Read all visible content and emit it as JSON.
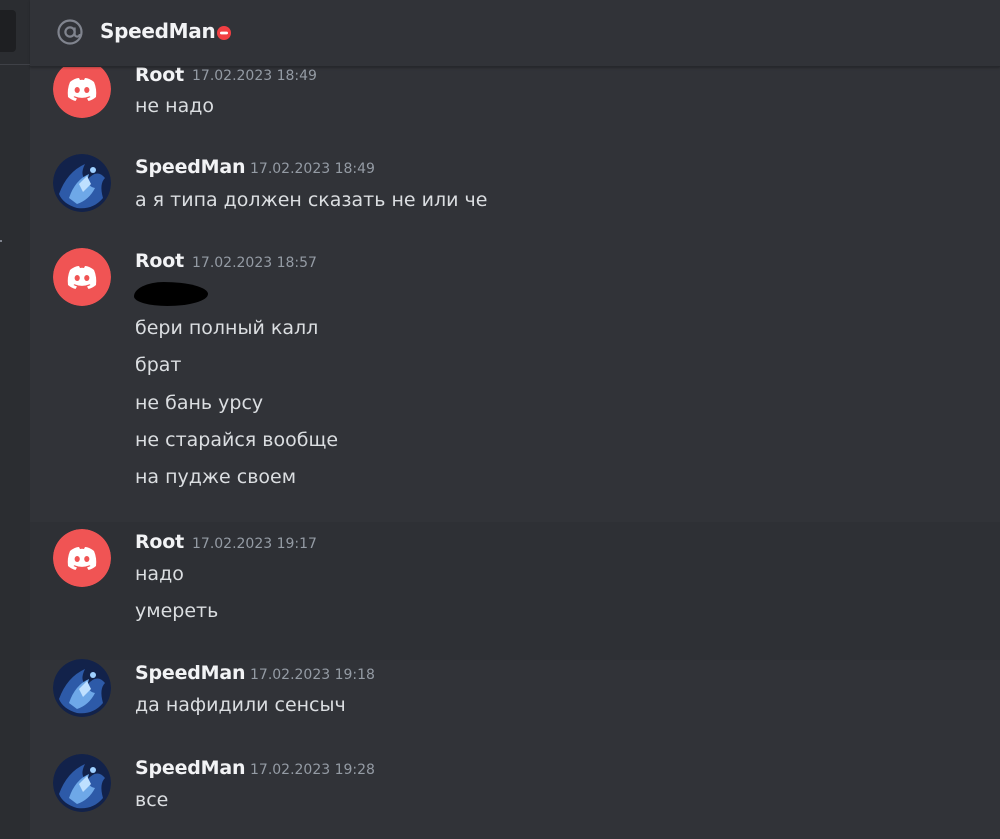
{
  "header": {
    "title": "SpeedMan",
    "at_icon": "at-sign-icon",
    "status_icon": "do-not-disturb-icon",
    "status_color": "#f23f43"
  },
  "colors": {
    "background": "#313338",
    "discord_avatar": "#f05454",
    "text": "#dbdee1",
    "muted": "#949ba4"
  },
  "messages": [
    {
      "author": "Root",
      "avatar": "discord-logo-avatar",
      "timestamp": "17.02.2023 18:49",
      "lines": [
        "не надо"
      ]
    },
    {
      "author": "SpeedMan",
      "avatar": "blue-character-avatar",
      "timestamp": "17.02.2023 18:49",
      "lines": [
        "а я типа должен сказать не или че"
      ]
    },
    {
      "author": "Root",
      "avatar": "discord-logo-avatar",
      "timestamp": "17.02.2023 18:57",
      "lines": [
        "бери полный калл",
        "брат",
        "не бань урсу",
        "не старайся вообще",
        "на пудже своем"
      ]
    },
    {
      "author": "Root",
      "avatar": "discord-logo-avatar",
      "timestamp": "17.02.2023 19:17",
      "lines": [
        "надо",
        "умереть"
      ]
    },
    {
      "author": "SpeedMan",
      "avatar": "blue-character-avatar",
      "timestamp": "17.02.2023 19:18",
      "lines": [
        "да нафидили сенсыч"
      ]
    },
    {
      "author": "SpeedMan",
      "avatar": "blue-character-avatar",
      "timestamp": "17.02.2023 19:28",
      "lines": [
        "все"
      ]
    }
  ]
}
